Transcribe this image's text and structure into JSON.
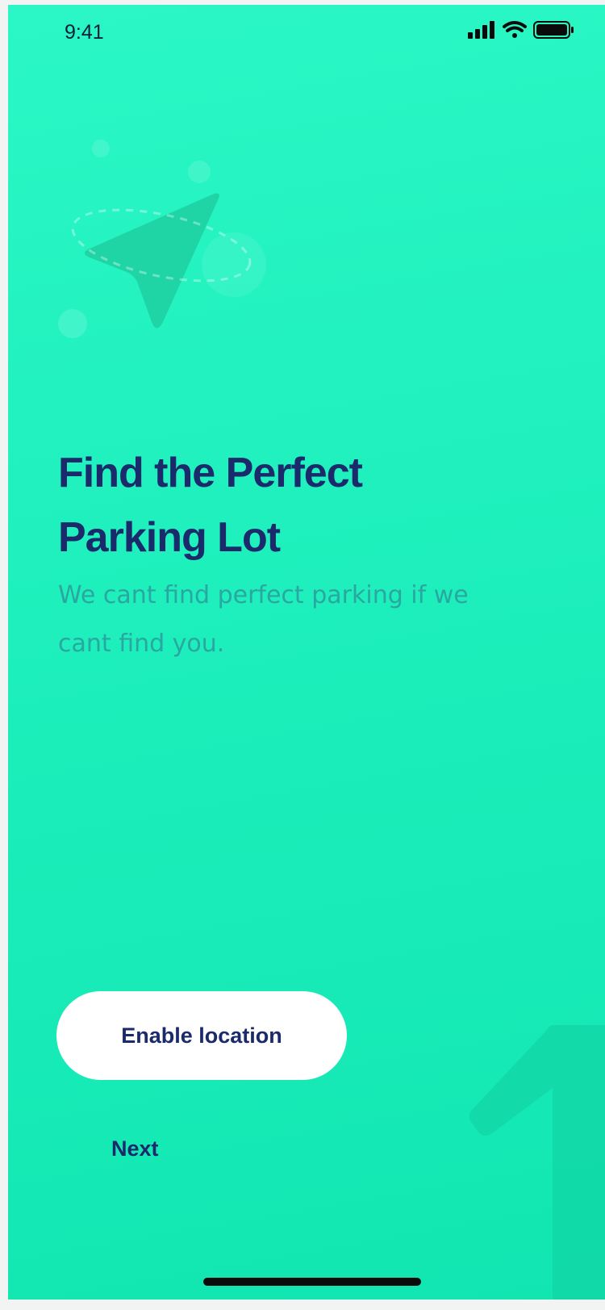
{
  "status_bar": {
    "time": "9:41",
    "icons": [
      "cellular-signal-icon",
      "wifi-icon",
      "battery-icon"
    ]
  },
  "onboarding": {
    "title_line1": "Find the Perfect",
    "title_line2": "Parking Lot",
    "subtitle": "We cant find perfect parking if we cant find you.",
    "hero_icon": "navigation-arrow-icon",
    "step_number": "1",
    "primary_button": "Enable location",
    "secondary_link": "Next"
  },
  "colors": {
    "background_start": "#2af7c5",
    "background_end": "#11e6b1",
    "title": "#1a2a6b",
    "subtitle": "#2aa7a0",
    "button_bg": "#ffffff",
    "button_text": "#1a2a6b"
  }
}
